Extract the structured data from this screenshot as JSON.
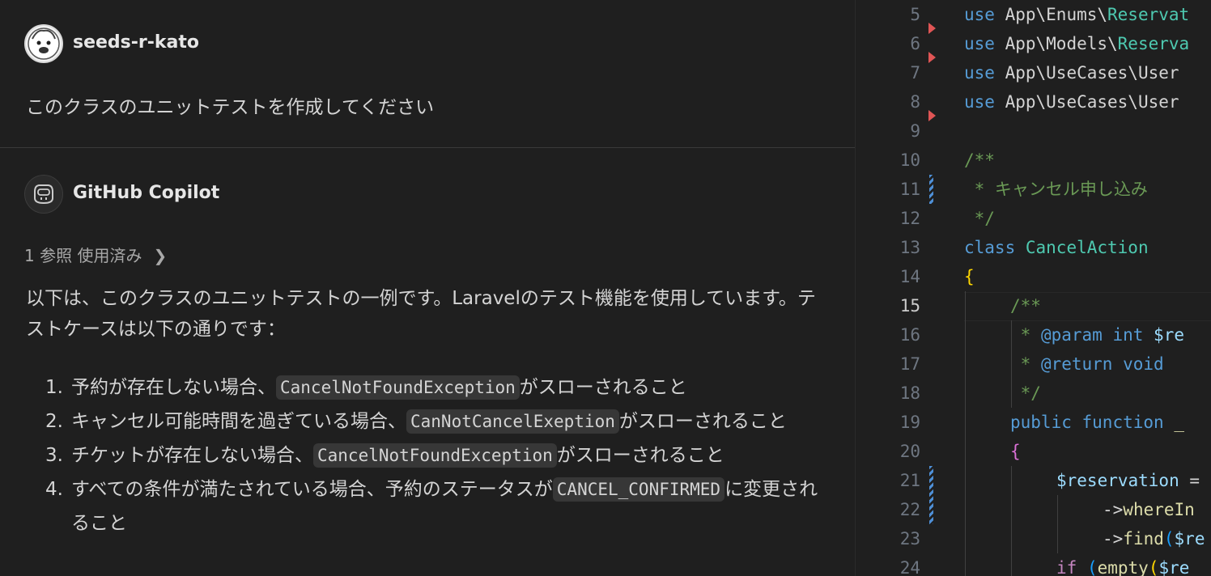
{
  "chat": {
    "user": {
      "name": "seeds-r-kato",
      "message": "このクラスのユニットテストを作成してください"
    },
    "assistant": {
      "name": "GitHub Copilot",
      "references": "1 参照 使用済み",
      "intro": "以下は、このクラスのユニットテストの一例です。Laravelのテスト機能を使用しています。テストケースは以下の通りです：",
      "items": [
        {
          "num": "1.",
          "before": "予約が存在しない場合、",
          "code": "CancelNotFoundException",
          "after": "がスローされること"
        },
        {
          "num": "2.",
          "before": "キャンセル可能時間を過ぎている場合、",
          "code": "CanNotCancelExeption",
          "after": "がスローされること"
        },
        {
          "num": "3.",
          "before": "チケットが存在しない場合、",
          "code": "CancelNotFoundException",
          "after": "がスローされること"
        },
        {
          "num": "4.",
          "before": "すべての条件が満たされている場合、予約のステータスが",
          "code": "CANCEL_CONFIRMED",
          "after": "に変更されること"
        }
      ]
    }
  },
  "editor": {
    "line_numbers": [
      "5",
      "6",
      "7",
      "8",
      "9",
      "10",
      "11",
      "12",
      "13",
      "14",
      "15",
      "16",
      "17",
      "18",
      "19",
      "20",
      "21",
      "22",
      "23",
      "24"
    ],
    "active_line": "15",
    "code": {
      "l5_kw": "use",
      "l5_ns": " App\\Enums\\",
      "l5_cls": "Reservat",
      "l6_kw": "use",
      "l6_ns": " App\\Models\\",
      "l6_cls": "Reserva",
      "l7_kw": "use",
      "l7_ns": " App\\UseCases\\User",
      "l8_kw": "use",
      "l8_ns": " App\\UseCases\\User",
      "l10": "/**",
      "l11": " * キャンセル申し込み",
      "l12": " */",
      "l13_kw": "class",
      "l13_cls": "CancelAction",
      "l14": "{",
      "l15": "/**",
      "l16_a": " * ",
      "l16_b": "@param",
      "l16_c": "int",
      "l16_d": "$re",
      "l17_a": " * ",
      "l17_b": "@return",
      "l17_c": "void",
      "l18": " */",
      "l19_a": "public",
      "l19_b": "function",
      "l19_c": "_",
      "l20": "{",
      "l21": "$reservation",
      "l21_op": " =",
      "l22_arrow": "->",
      "l22_fn": "whereIn",
      "l23_arrow": "->",
      "l23_fn": "find",
      "l23_paren": "(",
      "l23_var": "$re",
      "l24_kw": "if",
      "l24_paren": " (",
      "l24_fn": "empty",
      "l24_paren2": "(",
      "l24_var": "$re"
    }
  },
  "colors": {
    "keyword": "#569cd6",
    "class": "#4ec9b0",
    "comment": "#6a9955",
    "variable": "#9cdcfe",
    "function": "#dcdcaa",
    "diff_marker": "#e05555",
    "modified_bar": "#4e8fd6"
  }
}
